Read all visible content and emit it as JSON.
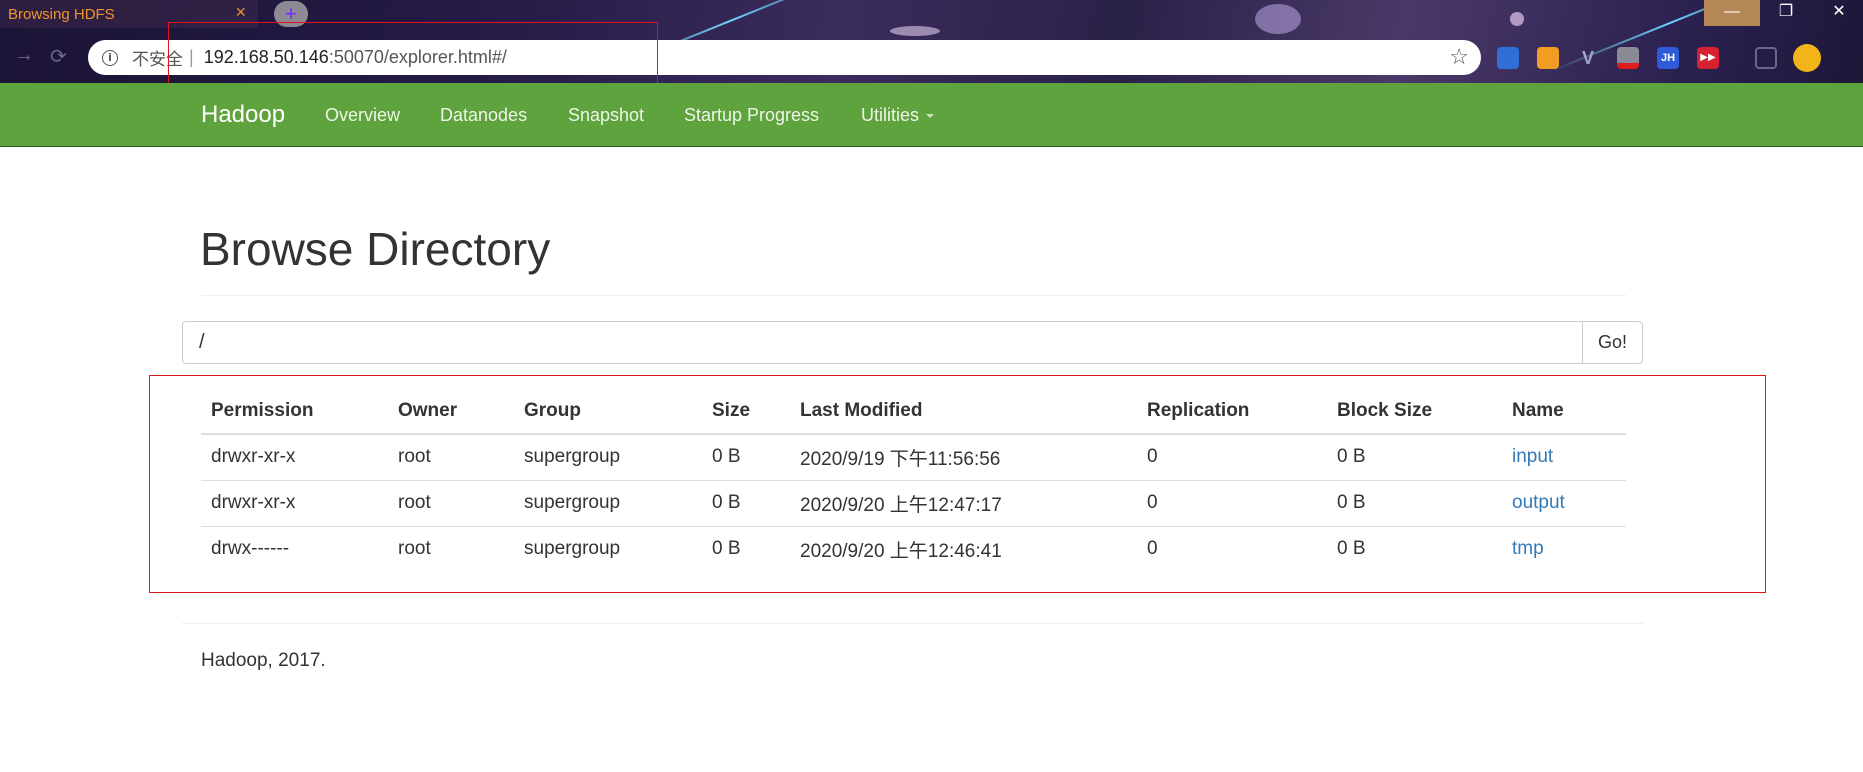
{
  "browser": {
    "tab_title": "Browsing HDFS",
    "tab_close": "×",
    "new_tab": "+",
    "back": "→",
    "reload": "⟳",
    "info_icon": "i",
    "security_label": "不安全",
    "url_separator": "|",
    "url_host": "192.168.50.146",
    "url_rest": ":50070/explorer.html#/",
    "star": "☆",
    "window_minimize": "—",
    "window_maximize": "❐",
    "window_close": "✕",
    "extensions": [
      "bookmark-ext-icon",
      "orange-ext-icon",
      "vue-devtools-icon",
      "screenshot-ext-icon",
      "jh-ext-icon",
      "media-ext-icon",
      "reading-list-icon",
      "profile-avatar-icon"
    ],
    "ext_labels": {
      "v": "V",
      "jh": "JH",
      "play": "▶▶"
    }
  },
  "navbar": {
    "brand": "Hadoop",
    "items": [
      "Overview",
      "Datanodes",
      "Snapshot",
      "Startup Progress",
      "Utilities"
    ]
  },
  "page": {
    "title": "Browse Directory",
    "path_value": "/",
    "go_label": "Go!"
  },
  "table": {
    "headers": [
      "Permission",
      "Owner",
      "Group",
      "Size",
      "Last Modified",
      "Replication",
      "Block Size",
      "Name"
    ],
    "rows": [
      [
        "drwxr-xr-x",
        "root",
        "supergroup",
        "0 B",
        "2020/9/19 下午11:56:56",
        "0",
        "0 B",
        "input"
      ],
      [
        "drwxr-xr-x",
        "root",
        "supergroup",
        "0 B",
        "2020/9/20 上午12:47:17",
        "0",
        "0 B",
        "output"
      ],
      [
        "drwx------",
        "root",
        "supergroup",
        "0 B",
        "2020/9/20 上午12:46:41",
        "0",
        "0 B",
        "tmp"
      ]
    ]
  },
  "footer": "Hadoop, 2017.",
  "colors": {
    "navbar_bg": "#5fa33e",
    "link": "#337ab7",
    "annotation_box": "#e0141e",
    "tab_title": "#f0932b"
  }
}
